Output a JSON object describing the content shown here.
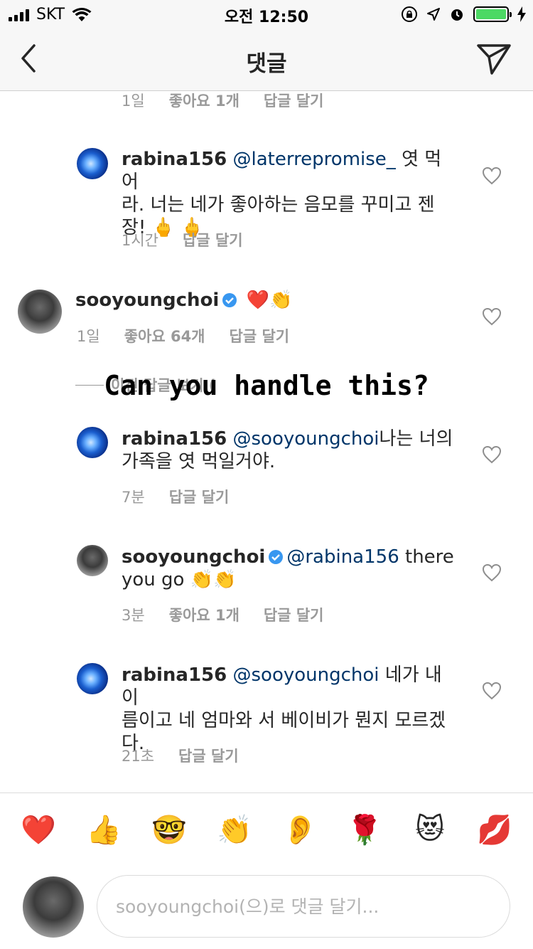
{
  "status_bar": {
    "carrier": "SKT",
    "time": "오전 12:50",
    "battery_color": "#4cd964"
  },
  "nav": {
    "title": "댓글",
    "back_icon": "chevron-left-icon",
    "send_icon": "paper-plane-icon"
  },
  "comments": [
    {
      "meta_time": "1일",
      "meta_likes": "좋아요 1개",
      "meta_reply": "답글 달기"
    },
    {
      "username": "rabina156",
      "mention": "@laterrepromise_",
      "text_line1_after": " 엿 먹어",
      "text_line2": "라. 너는 네가 좋아하는 음모를 꾸미고 젠",
      "text_line3": "장! 🖕 🖕",
      "meta_time": "1시간",
      "meta_reply": "답글 달기"
    },
    {
      "username": "sooyoungchoi",
      "text": "❤️👏",
      "meta_time": "1일",
      "meta_likes": "좋아요 64개",
      "meta_reply": "답글 달기"
    },
    {
      "username": "rabina156",
      "mention": "@sooyoungchoi",
      "text_line1_after": "나는 너의",
      "text_line2": "가족을 엿 먹일거야.",
      "meta_time": "7분",
      "meta_reply": "답글 달기"
    },
    {
      "username": "sooyoungchoi",
      "mention": "@rabina156",
      "text_line1_after": " there",
      "text_line2": "you go 👏👏",
      "meta_time": "3분",
      "meta_likes": "좋아요 1개",
      "meta_reply": "답글 달기"
    },
    {
      "username": "rabina156",
      "mention": "@sooyoungchoi",
      "text_line1_after": " 네가 내 이",
      "text_line2": "름이고 네 엄마와 서 베이비가 뭔지 모르겠",
      "text_line3": "다.",
      "meta_time": "21초",
      "meta_reply": "답글 달기"
    }
  ],
  "view_previous": "이전 답글 보기 (",
  "overlay": "Can you handle this?",
  "emoji_bar": [
    "❤️",
    "👍",
    "🤓",
    "👏",
    "👂",
    "🌹",
    "😻",
    "💋"
  ],
  "input": {
    "placeholder": "sooyoungchoi(으)로 댓글 달기..."
  }
}
